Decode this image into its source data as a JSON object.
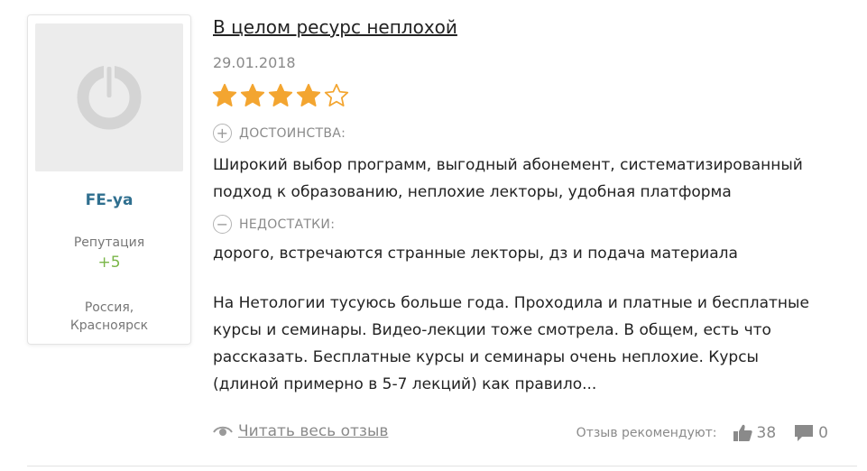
{
  "author": {
    "name": "FE-ya",
    "reputation_label": "Репутация",
    "reputation_value": "+5",
    "location_country": "Россия,",
    "location_city": "Красноярск"
  },
  "review": {
    "title": "В целом ресурс неплохой",
    "date": "29.01.2018",
    "rating": 4,
    "rating_max": 5,
    "pros_label": "ДОСТОИНСТВА:",
    "pros_line1": "Широкий выбор программ, выгодный абонемент, систематизированный",
    "pros_line2": "подход к образованию, неплохие лекторы, удобная платформа",
    "cons_label": "НЕДОСТАТКИ:",
    "cons_line1": "дорого, встречаются странные лекторы, дз и подача материала",
    "body_line1": "На Нетологии тусуюсь больше года. Проходила и платные и бесплатные",
    "body_line2": "курсы и семинары. Видео-лекции тоже смотрела. В общем, есть что",
    "body_line3": "рассказать. Бесплатные курсы и семинары очень неплохие. Курсы",
    "body_line4": "(длиной примерно в 5-7 лекций) как правило..."
  },
  "footer": {
    "read_more": "Читать весь отзыв",
    "recommend_label": "Отзыв рекомендуют:",
    "likes": "38",
    "comments": "0"
  },
  "colors": {
    "star_filled": "#f3a530",
    "author_name": "#2f6f8f",
    "reputation_positive": "#7ab648",
    "muted_text": "#8a8a8a"
  },
  "icons": {
    "avatar": "default-avatar-icon",
    "pros": "plus-circle-icon",
    "cons": "minus-circle-icon",
    "read_more": "eye-icon",
    "likes": "thumbs-up-icon",
    "comments": "comment-icon"
  }
}
